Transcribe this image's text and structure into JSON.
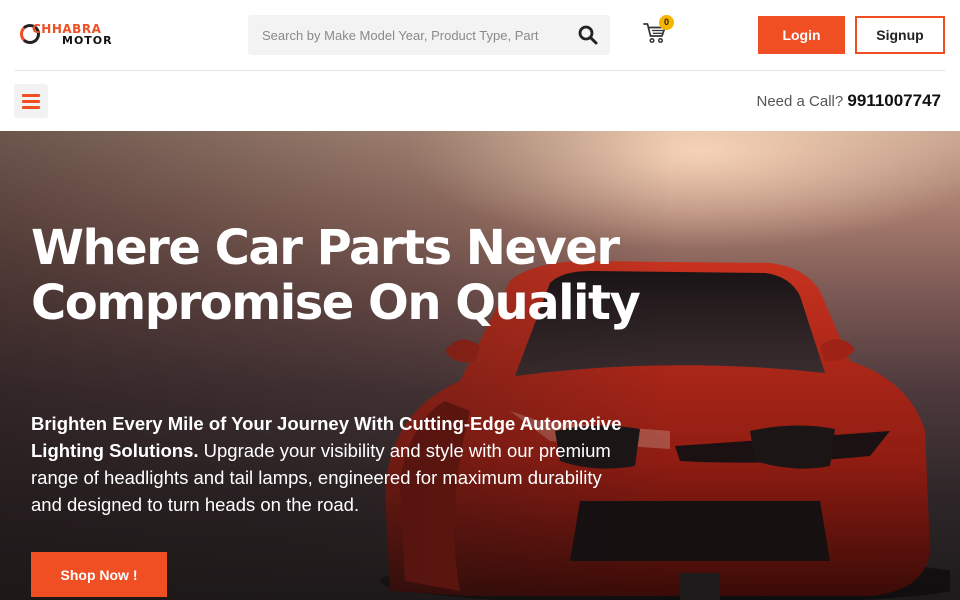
{
  "header": {
    "logo": {
      "brand_top": "CHHABRA",
      "brand_bottom": "MOTOR"
    },
    "search": {
      "placeholder": "Search by Make Model Year, Product Type, Part",
      "icon": "search-icon"
    },
    "cart": {
      "icon": "cart-icon",
      "count": "0"
    },
    "login_label": "Login",
    "signup_label": "Signup"
  },
  "subbar": {
    "menu_icon": "hamburger-menu-icon",
    "call_prefix": "Need a Call?",
    "phone": "9911007747"
  },
  "hero": {
    "title": "Where Car Parts Never Compromise On Quality",
    "subtitle_bold": "Brighten Every Mile of Your Journey With Cutting-Edge Automotive Lighting Solutions.",
    "subtitle_rest": " Upgrade your visibility and style with our premium range of headlights and tail lamps, engineered for maximum durability and designed to turn heads on the road.",
    "cta_label": "Shop Now !",
    "image": "red-sports-car-photo"
  },
  "colors": {
    "accent": "#f04e23",
    "badge": "#f7b500",
    "search_bg": "#f3f3f3"
  }
}
